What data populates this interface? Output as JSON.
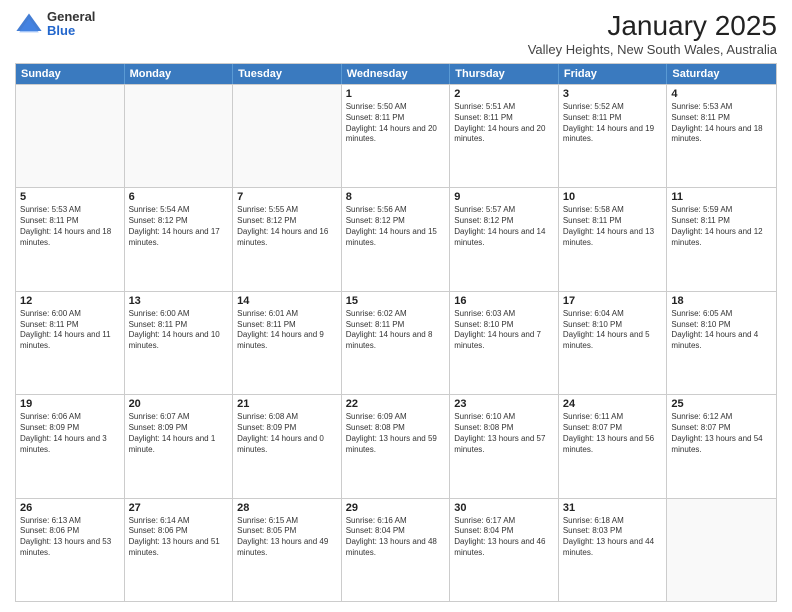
{
  "header": {
    "logo": {
      "general": "General",
      "blue": "Blue"
    },
    "title": "January 2025",
    "subtitle": "Valley Heights, New South Wales, Australia"
  },
  "days_of_week": [
    "Sunday",
    "Monday",
    "Tuesday",
    "Wednesday",
    "Thursday",
    "Friday",
    "Saturday"
  ],
  "weeks": [
    [
      {
        "day": "",
        "empty": true
      },
      {
        "day": "",
        "empty": true
      },
      {
        "day": "",
        "empty": true
      },
      {
        "day": "1",
        "sunrise": "5:50 AM",
        "sunset": "8:11 PM",
        "daylight": "14 hours and 20 minutes."
      },
      {
        "day": "2",
        "sunrise": "5:51 AM",
        "sunset": "8:11 PM",
        "daylight": "14 hours and 20 minutes."
      },
      {
        "day": "3",
        "sunrise": "5:52 AM",
        "sunset": "8:11 PM",
        "daylight": "14 hours and 19 minutes."
      },
      {
        "day": "4",
        "sunrise": "5:53 AM",
        "sunset": "8:11 PM",
        "daylight": "14 hours and 18 minutes."
      }
    ],
    [
      {
        "day": "5",
        "sunrise": "5:53 AM",
        "sunset": "8:11 PM",
        "daylight": "14 hours and 18 minutes."
      },
      {
        "day": "6",
        "sunrise": "5:54 AM",
        "sunset": "8:12 PM",
        "daylight": "14 hours and 17 minutes."
      },
      {
        "day": "7",
        "sunrise": "5:55 AM",
        "sunset": "8:12 PM",
        "daylight": "14 hours and 16 minutes."
      },
      {
        "day": "8",
        "sunrise": "5:56 AM",
        "sunset": "8:12 PM",
        "daylight": "14 hours and 15 minutes."
      },
      {
        "day": "9",
        "sunrise": "5:57 AM",
        "sunset": "8:12 PM",
        "daylight": "14 hours and 14 minutes."
      },
      {
        "day": "10",
        "sunrise": "5:58 AM",
        "sunset": "8:11 PM",
        "daylight": "14 hours and 13 minutes."
      },
      {
        "day": "11",
        "sunrise": "5:59 AM",
        "sunset": "8:11 PM",
        "daylight": "14 hours and 12 minutes."
      }
    ],
    [
      {
        "day": "12",
        "sunrise": "6:00 AM",
        "sunset": "8:11 PM",
        "daylight": "14 hours and 11 minutes."
      },
      {
        "day": "13",
        "sunrise": "6:00 AM",
        "sunset": "8:11 PM",
        "daylight": "14 hours and 10 minutes."
      },
      {
        "day": "14",
        "sunrise": "6:01 AM",
        "sunset": "8:11 PM",
        "daylight": "14 hours and 9 minutes."
      },
      {
        "day": "15",
        "sunrise": "6:02 AM",
        "sunset": "8:11 PM",
        "daylight": "14 hours and 8 minutes."
      },
      {
        "day": "16",
        "sunrise": "6:03 AM",
        "sunset": "8:10 PM",
        "daylight": "14 hours and 7 minutes."
      },
      {
        "day": "17",
        "sunrise": "6:04 AM",
        "sunset": "8:10 PM",
        "daylight": "14 hours and 5 minutes."
      },
      {
        "day": "18",
        "sunrise": "6:05 AM",
        "sunset": "8:10 PM",
        "daylight": "14 hours and 4 minutes."
      }
    ],
    [
      {
        "day": "19",
        "sunrise": "6:06 AM",
        "sunset": "8:09 PM",
        "daylight": "14 hours and 3 minutes."
      },
      {
        "day": "20",
        "sunrise": "6:07 AM",
        "sunset": "8:09 PM",
        "daylight": "14 hours and 1 minute."
      },
      {
        "day": "21",
        "sunrise": "6:08 AM",
        "sunset": "8:09 PM",
        "daylight": "14 hours and 0 minutes."
      },
      {
        "day": "22",
        "sunrise": "6:09 AM",
        "sunset": "8:08 PM",
        "daylight": "13 hours and 59 minutes."
      },
      {
        "day": "23",
        "sunrise": "6:10 AM",
        "sunset": "8:08 PM",
        "daylight": "13 hours and 57 minutes."
      },
      {
        "day": "24",
        "sunrise": "6:11 AM",
        "sunset": "8:07 PM",
        "daylight": "13 hours and 56 minutes."
      },
      {
        "day": "25",
        "sunrise": "6:12 AM",
        "sunset": "8:07 PM",
        "daylight": "13 hours and 54 minutes."
      }
    ],
    [
      {
        "day": "26",
        "sunrise": "6:13 AM",
        "sunset": "8:06 PM",
        "daylight": "13 hours and 53 minutes."
      },
      {
        "day": "27",
        "sunrise": "6:14 AM",
        "sunset": "8:06 PM",
        "daylight": "13 hours and 51 minutes."
      },
      {
        "day": "28",
        "sunrise": "6:15 AM",
        "sunset": "8:05 PM",
        "daylight": "13 hours and 49 minutes."
      },
      {
        "day": "29",
        "sunrise": "6:16 AM",
        "sunset": "8:04 PM",
        "daylight": "13 hours and 48 minutes."
      },
      {
        "day": "30",
        "sunrise": "6:17 AM",
        "sunset": "8:04 PM",
        "daylight": "13 hours and 46 minutes."
      },
      {
        "day": "31",
        "sunrise": "6:18 AM",
        "sunset": "8:03 PM",
        "daylight": "13 hours and 44 minutes."
      },
      {
        "day": "",
        "empty": true
      }
    ]
  ]
}
